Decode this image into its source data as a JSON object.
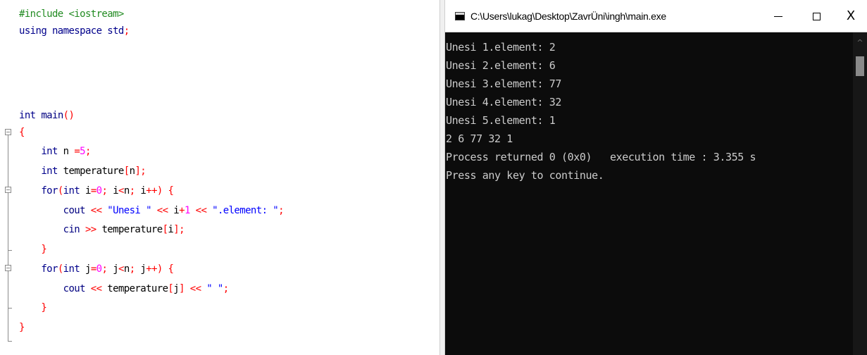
{
  "editor": {
    "lines": [
      {
        "tokens": [
          {
            "t": "#include <iostream>",
            "c": "pp"
          }
        ]
      },
      {
        "tokens": [
          {
            "t": "using namespace std",
            "c": "kw"
          },
          {
            "t": ";",
            "c": "op"
          }
        ]
      },
      {
        "tokens": []
      },
      {
        "tokens": []
      },
      {
        "tokens": []
      },
      {
        "tokens": [
          {
            "t": "int",
            "c": "kw"
          },
          {
            "t": " main",
            "c": "fn"
          },
          {
            "t": "()",
            "c": "op"
          }
        ]
      },
      {
        "tokens": [
          {
            "t": "{",
            "c": "op"
          }
        ]
      },
      {
        "tokens": [
          {
            "t": "    int",
            "c": "kw"
          },
          {
            "t": " n ",
            "c": "id"
          },
          {
            "t": "=",
            "c": "op"
          },
          {
            "t": "5",
            "c": "num"
          },
          {
            "t": ";",
            "c": "op"
          }
        ]
      },
      {
        "tokens": [
          {
            "t": "    int",
            "c": "kw"
          },
          {
            "t": " temperature",
            "c": "id"
          },
          {
            "t": "[",
            "c": "op"
          },
          {
            "t": "n",
            "c": "id"
          },
          {
            "t": "];",
            "c": "op"
          }
        ]
      },
      {
        "tokens": [
          {
            "t": "    for",
            "c": "kw"
          },
          {
            "t": "(",
            "c": "op"
          },
          {
            "t": "int",
            "c": "kw"
          },
          {
            "t": " i",
            "c": "id"
          },
          {
            "t": "=",
            "c": "op"
          },
          {
            "t": "0",
            "c": "num"
          },
          {
            "t": ";",
            "c": "op"
          },
          {
            "t": " i",
            "c": "id"
          },
          {
            "t": "<",
            "c": "op"
          },
          {
            "t": "n",
            "c": "id"
          },
          {
            "t": ";",
            "c": "op"
          },
          {
            "t": " i",
            "c": "id"
          },
          {
            "t": "++) {",
            "c": "op"
          }
        ]
      },
      {
        "tokens": [
          {
            "t": "        cout ",
            "c": "fn"
          },
          {
            "t": "<<",
            "c": "op"
          },
          {
            "t": " \"Unesi \" ",
            "c": "str"
          },
          {
            "t": "<<",
            "c": "op"
          },
          {
            "t": " i",
            "c": "id"
          },
          {
            "t": "+",
            "c": "op"
          },
          {
            "t": "1",
            "c": "num"
          },
          {
            "t": " << ",
            "c": "op"
          },
          {
            "t": "\".element: \"",
            "c": "str"
          },
          {
            "t": ";",
            "c": "op"
          }
        ]
      },
      {
        "tokens": [
          {
            "t": "        cin ",
            "c": "fn"
          },
          {
            "t": ">>",
            "c": "op"
          },
          {
            "t": " temperature",
            "c": "id"
          },
          {
            "t": "[",
            "c": "op"
          },
          {
            "t": "i",
            "c": "id"
          },
          {
            "t": "];",
            "c": "op"
          }
        ]
      },
      {
        "tokens": [
          {
            "t": "    }",
            "c": "op"
          }
        ]
      },
      {
        "tokens": [
          {
            "t": "    for",
            "c": "kw"
          },
          {
            "t": "(",
            "c": "op"
          },
          {
            "t": "int",
            "c": "kw"
          },
          {
            "t": " j",
            "c": "id"
          },
          {
            "t": "=",
            "c": "op"
          },
          {
            "t": "0",
            "c": "num"
          },
          {
            "t": ";",
            "c": "op"
          },
          {
            "t": " j",
            "c": "id"
          },
          {
            "t": "<",
            "c": "op"
          },
          {
            "t": "n",
            "c": "id"
          },
          {
            "t": ";",
            "c": "op"
          },
          {
            "t": " j",
            "c": "id"
          },
          {
            "t": "++) {",
            "c": "op"
          }
        ]
      },
      {
        "tokens": [
          {
            "t": "        cout ",
            "c": "fn"
          },
          {
            "t": "<<",
            "c": "op"
          },
          {
            "t": " temperature",
            "c": "id"
          },
          {
            "t": "[",
            "c": "op"
          },
          {
            "t": "j",
            "c": "id"
          },
          {
            "t": "]",
            "c": "op"
          },
          {
            "t": " << ",
            "c": "op"
          },
          {
            "t": "\" \"",
            "c": "str"
          },
          {
            "t": ";",
            "c": "op"
          }
        ]
      },
      {
        "tokens": [
          {
            "t": "    }",
            "c": "op"
          }
        ]
      },
      {
        "tokens": [
          {
            "t": "}",
            "c": "op"
          }
        ]
      }
    ],
    "colors": {
      "pp": "#228b22",
      "kw": "#00008b",
      "id": "#000000",
      "op": "#ff0000",
      "num": "#ff00ff",
      "str": "#0000ff",
      "fn": "#000080"
    }
  },
  "console": {
    "title": "C:\\Users\\lukag\\Desktop\\ZavrÜni\\ingh\\main.exe",
    "close_label": "X",
    "background": "#0c0c0c",
    "text_color": "#cccccc",
    "lines": [
      "Unesi 1.element: 2",
      "Unesi 2.element: 6",
      "Unesi 3.element: 77",
      "Unesi 4.element: 32",
      "Unesi 5.element: 1",
      "2 6 77 32 1",
      "Process returned 0 (0x0)   execution time : 3.355 s",
      "Press any key to continue."
    ],
    "icons": {
      "app": "console-app-icon",
      "minimize": "minimize-icon",
      "maximize": "maximize-icon",
      "close": "close-icon",
      "scroll_up": "scroll-up-arrow-icon"
    }
  }
}
